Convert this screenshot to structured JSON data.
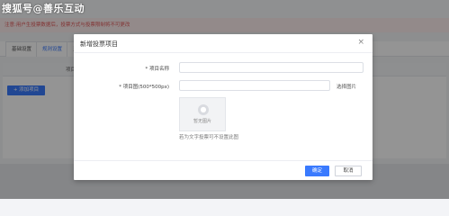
{
  "watermark": "搜狐号@善乐互动",
  "notice": "注意:用户生投票数据后，投票方式与投票限制将不可更改",
  "tabs": [
    {
      "label": "基础设置"
    },
    {
      "label": "规则设置"
    },
    {
      "label": "显"
    }
  ],
  "table": {
    "header": "项目"
  },
  "add_button": "+ 添加项目",
  "modal": {
    "title": "新增投票项目",
    "close": "×",
    "name_label": "* 项目名称",
    "image_label": "* 项目图(500*500px)",
    "pick_image": "选择图片",
    "upload_placeholder": "暂无图片",
    "hint": "若为文字投票可不设置此图",
    "ok": "确定",
    "cancel": "取消"
  }
}
